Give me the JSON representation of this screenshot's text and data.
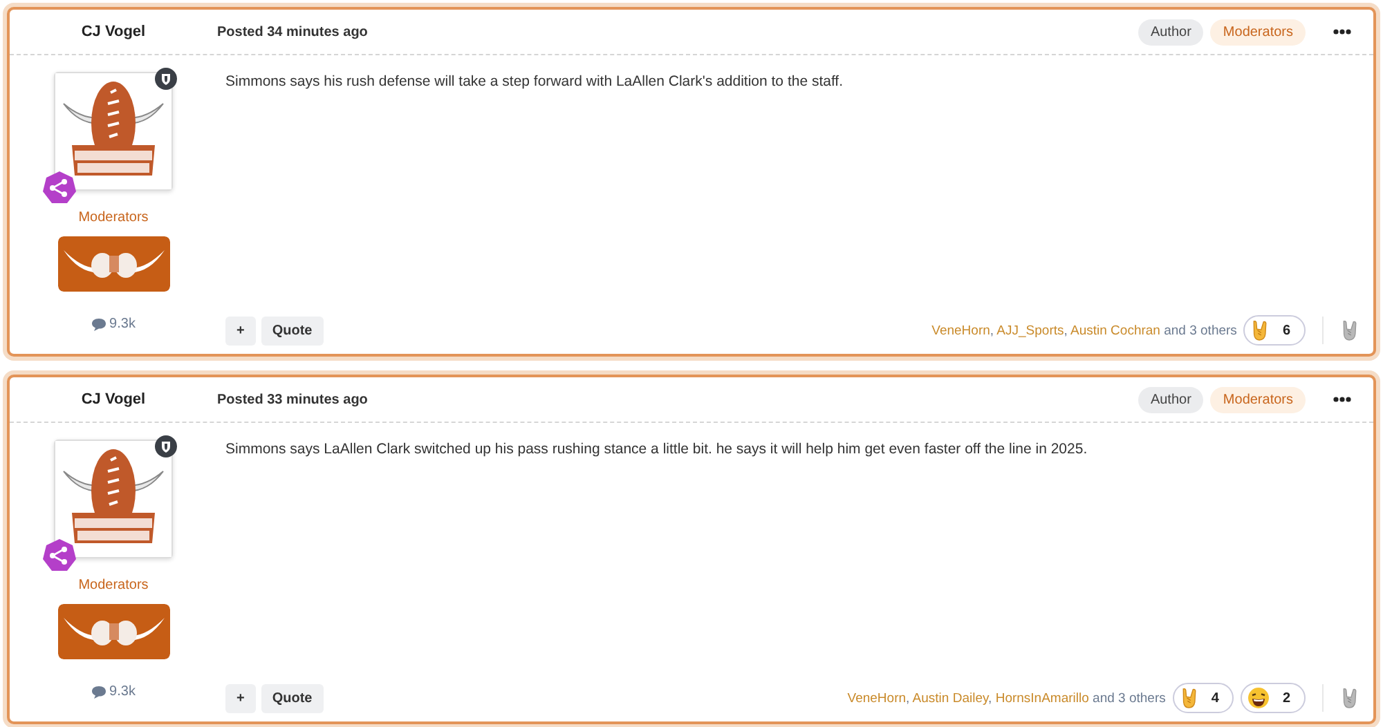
{
  "posts": [
    {
      "author": "CJ Vogel",
      "posted": "Posted 34 minutes ago",
      "badges": [
        {
          "label": "Author",
          "kind": "author"
        },
        {
          "label": "Moderators",
          "kind": "group"
        }
      ],
      "group": "Moderators",
      "post_count": "9.3k",
      "body": "Simmons says his rush defense will take a step forward with LaAllen Clark's addition to the staff.",
      "actions": [
        "+",
        "Quote"
      ],
      "reactors": [
        "VeneHorn",
        "AJJ_Sports",
        "Austin Cochran"
      ],
      "reactors_separator": ",",
      "others": "and 3 others",
      "reactions": [
        {
          "kind": "rock",
          "count": "6"
        }
      ]
    },
    {
      "author": "CJ Vogel",
      "posted": "Posted 33 minutes ago",
      "badges": [
        {
          "label": "Author",
          "kind": "author"
        },
        {
          "label": "Moderators",
          "kind": "group"
        }
      ],
      "group": "Moderators",
      "post_count": "9.3k",
      "body": "Simmons says LaAllen Clark switched up his pass rushing stance a little bit. he says it will help him get even faster off the line in 2025.",
      "actions": [
        "+",
        "Quote"
      ],
      "reactors": [
        "VeneHorn",
        "Austin Dailey",
        "HornsInAmarillo"
      ],
      "reactors_separator": ",",
      "others": "and 3 others",
      "reactions": [
        {
          "kind": "rock",
          "count": "4"
        },
        {
          "kind": "laugh",
          "count": "2"
        }
      ]
    }
  ]
}
